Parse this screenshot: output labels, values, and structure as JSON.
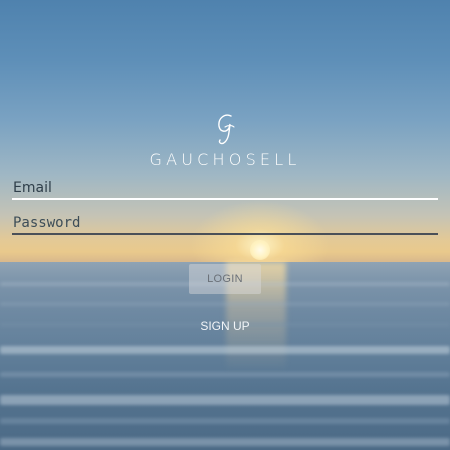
{
  "app": {
    "brand_name": "GAUCHOSELL",
    "logo_icon": "script-g-logo-icon"
  },
  "login_form": {
    "email_placeholder": "Email",
    "email_value": "",
    "password_placeholder": "Password",
    "password_value": "",
    "login_label": "LOGIN",
    "signup_label": "SIGN UP"
  },
  "colors": {
    "email_underline": "#ffffff",
    "password_underline": "#4a5058",
    "login_button_bg": "#dcdcde",
    "text_white": "#ffffff"
  }
}
